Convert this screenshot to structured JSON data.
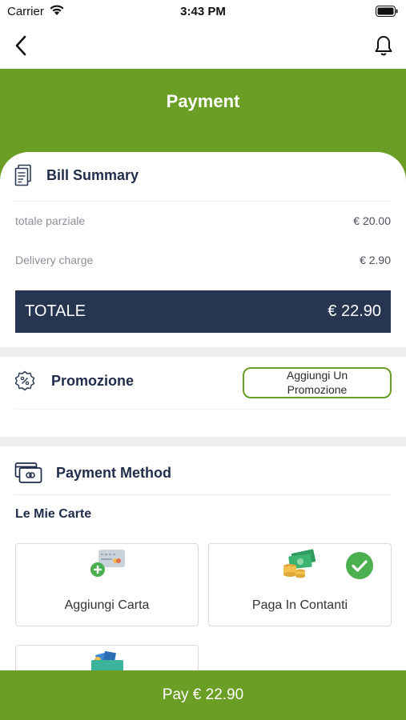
{
  "status_bar": {
    "carrier": "Carrier",
    "time": "3:43 PM"
  },
  "header": {
    "title": "Payment"
  },
  "bill": {
    "title": "Bill Summary",
    "rows": [
      {
        "label": "totale parziale",
        "value": "€ 20.00"
      },
      {
        "label": "Delivery charge",
        "value": "€ 2.90"
      }
    ],
    "total_label": "TOTALE",
    "total_value": "€ 22.90"
  },
  "promo": {
    "title": "Promozione",
    "button_line1": "Aggiungi Un",
    "button_line2": "Promozione"
  },
  "payment": {
    "title": "Payment Method",
    "subtitle": "Le Mie Carte",
    "methods": [
      {
        "label": "Aggiungi Carta",
        "icon": "add-card-icon"
      },
      {
        "label": "Paga In Contanti",
        "icon": "cash-icon",
        "selected": true
      },
      {
        "label": "",
        "icon": "wallet-icon"
      }
    ]
  },
  "pay_button": {
    "label": "Pay € 22.90"
  },
  "colors": {
    "brand_green": "#6a9e25",
    "navy": "#263650"
  }
}
